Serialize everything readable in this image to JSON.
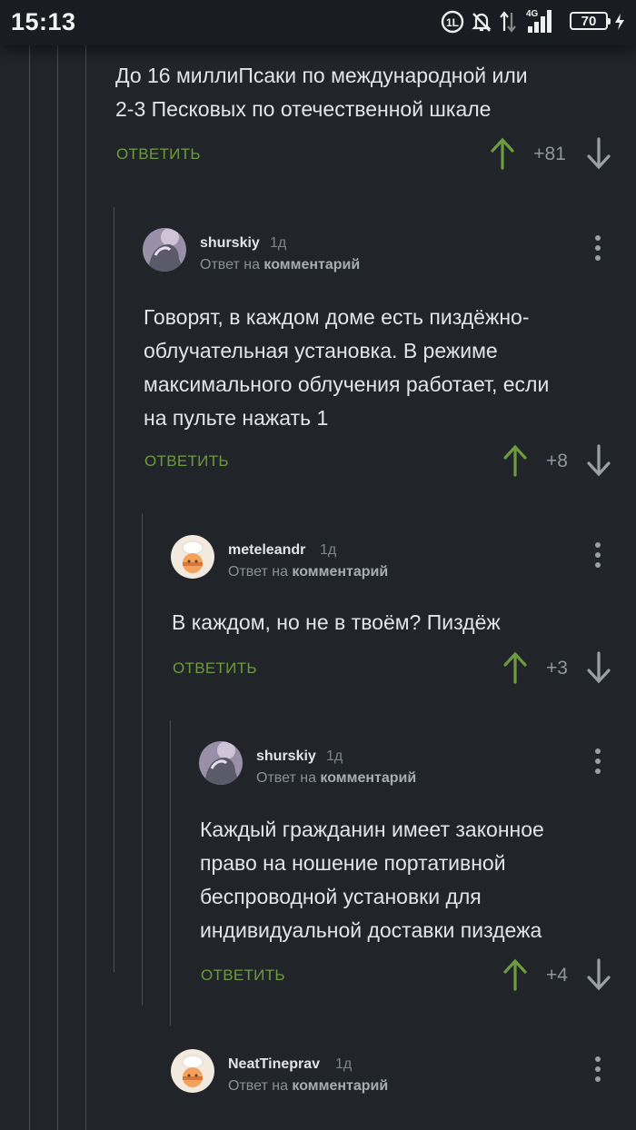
{
  "status_bar": {
    "time": "15:13",
    "battery": "70"
  },
  "comments": [
    {
      "text_lines": [
        "До 16 миллиПсаки по международной или",
        "2-3 Песковых по отечественной шкале"
      ],
      "reply_label": "ОТВЕТИТЬ",
      "score": "+81"
    },
    {
      "author": "shurskiy",
      "age": "1д",
      "reply_prefix": "Ответ на",
      "reply_target": "комментарий",
      "text_lines": [
        "Говорят, в каждом доме есть пиздёжно-",
        "облучательная установка. В режиме",
        "максимального облучения работает, если",
        "на пульте нажать 1"
      ],
      "reply_label": "ОТВЕТИТЬ",
      "score": "+8"
    },
    {
      "author": "meteleandr",
      "age": "1д",
      "reply_prefix": "Ответ на",
      "reply_target": "комментарий",
      "text_lines": [
        "В каждом, но не в твоём? Пиздёж"
      ],
      "reply_label": "ОТВЕТИТЬ",
      "score": "+3"
    },
    {
      "author": "shurskiy",
      "age": "1д",
      "reply_prefix": "Ответ на",
      "reply_target": "комментарий",
      "text_lines": [
        "Каждый гражданин имеет законное",
        "право на ношение портативной",
        "беспроводной установки для",
        "индивидуальной доставки пиздежа"
      ],
      "reply_label": "ОТВЕТИТЬ",
      "score": "+4"
    },
    {
      "author": "NeatTineprav",
      "age": "1д",
      "reply_prefix": "Ответ на",
      "reply_target": "комментарий"
    }
  ],
  "colors": {
    "background": "#212529",
    "reply": "#6c9a3e",
    "upvote": "#6c9a3e",
    "downvote": "#9aa0a6"
  }
}
